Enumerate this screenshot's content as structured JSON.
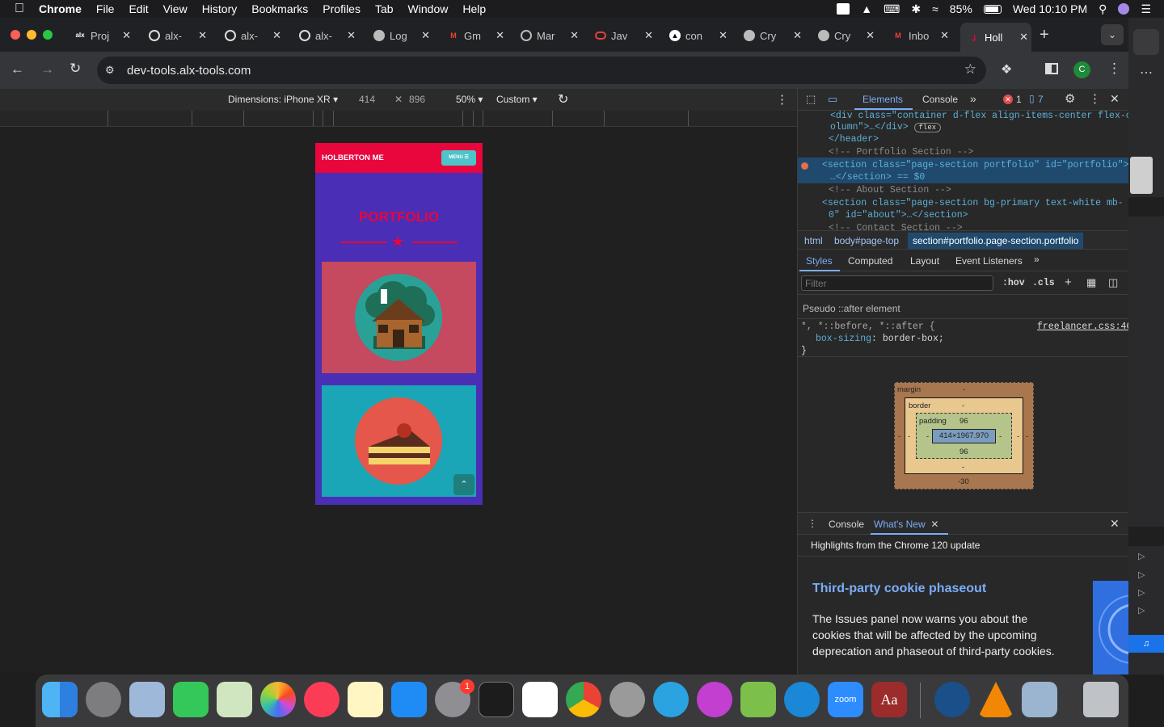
{
  "menubar": {
    "app": "Chrome",
    "items": [
      "File",
      "Edit",
      "View",
      "History",
      "Bookmarks",
      "Profiles",
      "Tab",
      "Window",
      "Help"
    ],
    "battery": "85%",
    "clock": "Wed 10:10 PM"
  },
  "tabs": [
    {
      "label": "Proj",
      "icon": "alx-icon"
    },
    {
      "label": "alx-",
      "icon": "github-icon"
    },
    {
      "label": "alx-",
      "icon": "github-icon"
    },
    {
      "label": "alx-",
      "icon": "github-icon"
    },
    {
      "label": "Log",
      "icon": "globe-icon"
    },
    {
      "label": "Gm",
      "icon": "gmail-icon"
    },
    {
      "label": "Mar",
      "icon": "openai-icon"
    },
    {
      "label": "Jav",
      "icon": "oracle-icon"
    },
    {
      "label": "con",
      "icon": "triangle-icon"
    },
    {
      "label": "Cry",
      "icon": "globe-icon"
    },
    {
      "label": "Cry",
      "icon": "globe-icon"
    },
    {
      "label": "Inbo",
      "icon": "gmail-icon"
    },
    {
      "label": "Holl",
      "icon": "holberton-icon",
      "active": true
    }
  ],
  "address": {
    "url": "dev-tools.alx-tools.com",
    "profile_initial": "C"
  },
  "device_toolbar": {
    "dimensions": "Dimensions: iPhone XR",
    "width": "414",
    "height": "896",
    "zoom": "50%",
    "throttle": "Custom"
  },
  "phone": {
    "brand": "HOLBERTON ME",
    "menu": "MENU",
    "heading": "PORTFOLIO",
    "colors": {
      "nav": "#e8063c",
      "bg": "#4a2eb5",
      "card1": "#c5495f",
      "card2": "#1aa6b6"
    }
  },
  "devtools": {
    "tabs": [
      "Elements",
      "Console"
    ],
    "errors": "1",
    "messages": "7",
    "dom_lines": [
      {
        "text": "<div class=\"container d-flex align-items-center flex-c"
      },
      {
        "text": "olumn\">…</div>",
        "badge": "flex"
      },
      {
        "text": "</header>"
      },
      {
        "text": "<!-- Portfolio Section -->"
      },
      {
        "text": "<section class=\"page-section portfolio\" id=\"portfolio\">"
      },
      {
        "text": "…</section> == $0"
      },
      {
        "text": "<!-- About Section -->"
      },
      {
        "text": "<section class=\"page-section bg-primary text-white mb-"
      },
      {
        "text": "0\" id=\"about\">…</section>"
      },
      {
        "text": "<!-- Contact Section -->"
      }
    ],
    "breadcrumbs": [
      "html",
      "body#page-top",
      "section#portfolio.page-section.portfolio"
    ],
    "style_tabs": [
      "Styles",
      "Computed",
      "Layout",
      "Event Listeners"
    ],
    "filter_placeholder": "Filter",
    "hov": ":hov",
    "cls": ".cls",
    "pseudo_header": "Pseudo ::after element",
    "rule_selector": "*, *::before, *::after {",
    "rule_source": "freelancer.css:46",
    "rule_prop": "box-sizing",
    "rule_value": "border-box;",
    "rule_close": "}",
    "boxmodel": {
      "margin_label": "margin",
      "margin_top": "-",
      "margin_bottom": "-30",
      "margin_left": "-",
      "margin_right": "-",
      "border_label": "border",
      "border_top": "-",
      "border_bottom": "-",
      "border_left": "-",
      "border_right": "-",
      "padding_label": "padding",
      "padding_top": "96",
      "padding_bottom": "96",
      "padding_left": "-",
      "padding_right": "-",
      "content": "414×1967.970"
    },
    "drawer_tabs": [
      "Console",
      "What's New"
    ],
    "drawer_subtitle": "Highlights from the Chrome 120 update",
    "article_title": "Third-party cookie phaseout",
    "article_body": "The Issues panel now warns you about the cookies that will be affected by the upcoming deprecation and phaseout of third-party cookies."
  },
  "dock": [
    "finder-icon",
    "launchpad-icon",
    "preview-icon",
    "facetime-icon",
    "maps-icon",
    "photos-icon",
    "music-icon",
    "notes-icon",
    "appstore-icon",
    "settings-icon",
    "terminal-icon",
    "vscode-icon",
    "chrome-icon",
    "whatsapp-icon",
    "telegram-icon",
    "winamp-icon",
    "android-studio-icon",
    "edge-icon",
    "zoom-icon",
    "dictionary-icon",
    "quicktime-icon",
    "vlc-icon",
    "image-capture-icon",
    "trash-icon"
  ],
  "dock_labels": {
    "zoom": "zoom",
    "dictionary": "Aa",
    "settings_badge": "1"
  }
}
